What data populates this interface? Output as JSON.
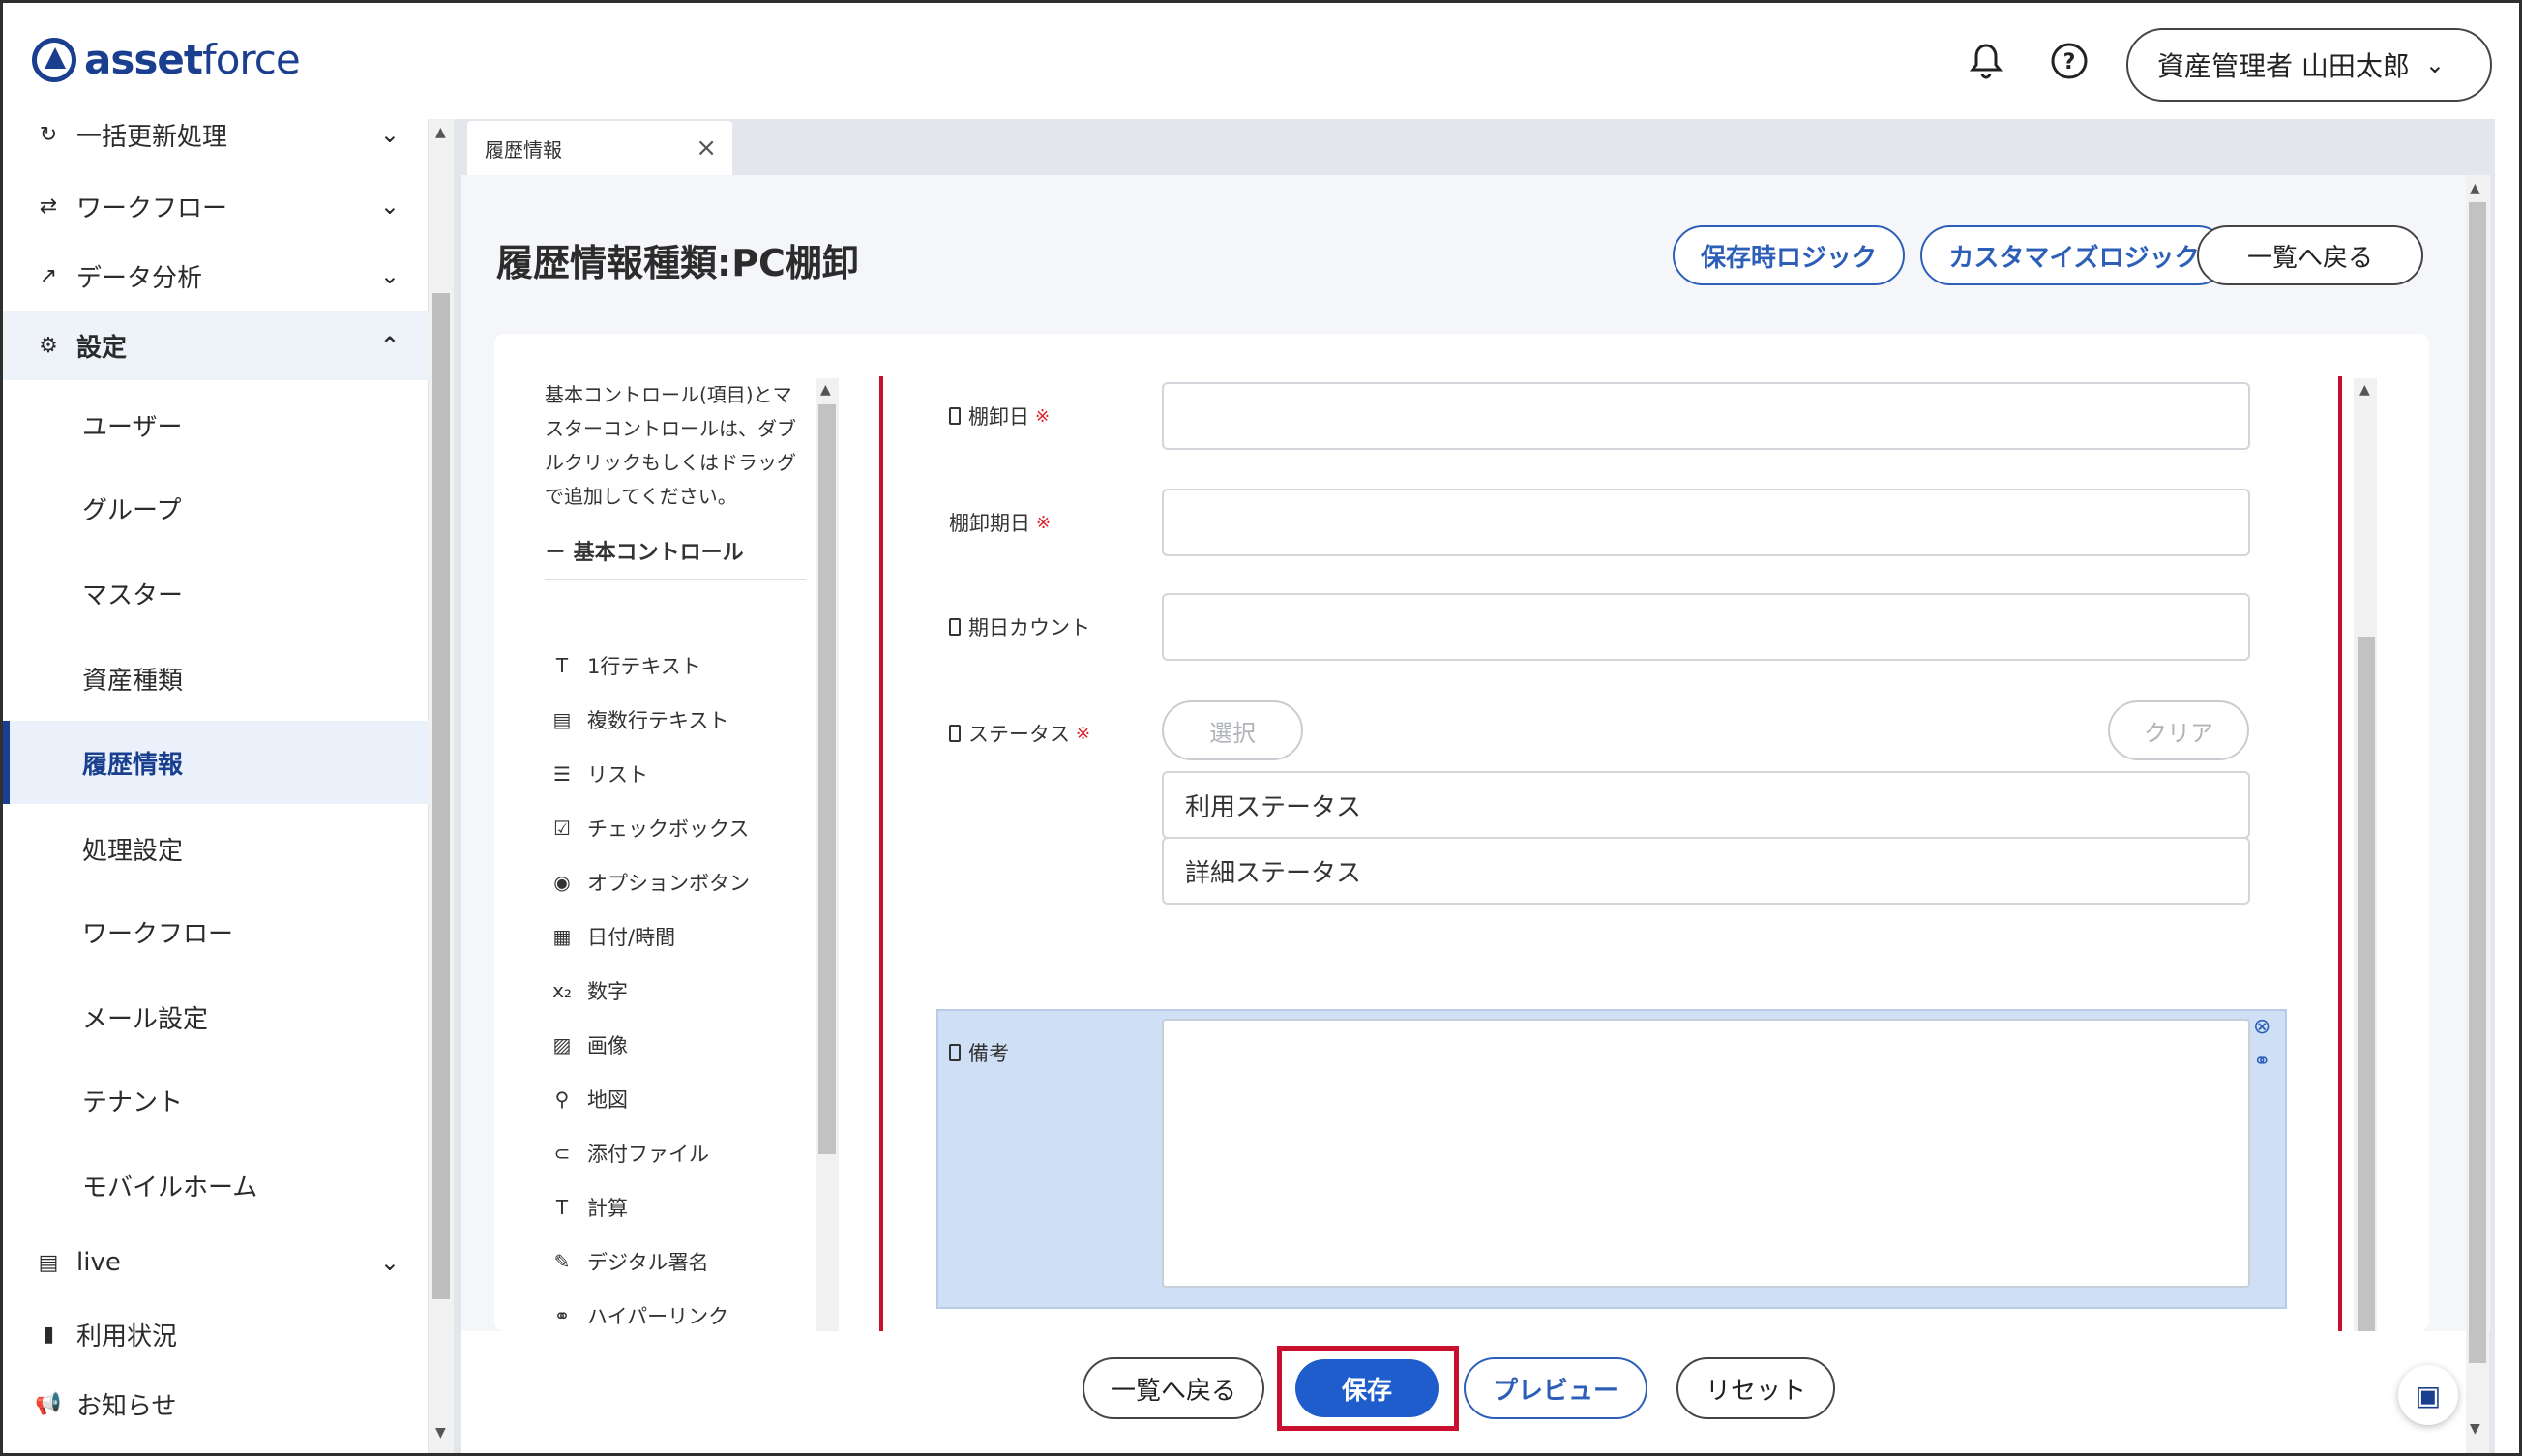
{
  "header": {
    "logo_prefix": "asset",
    "logo_suffix": "force",
    "user_label": "資産管理者 山田太郎"
  },
  "sidebar": {
    "items": [
      {
        "label": "一括更新処理",
        "icon": "refresh-icon"
      },
      {
        "label": "ワークフロー",
        "icon": "workflow-icon"
      },
      {
        "label": "データ分析",
        "icon": "analytics-icon"
      },
      {
        "label": "設定",
        "icon": "gear-icon"
      },
      {
        "label": "ユーザー"
      },
      {
        "label": "グループ"
      },
      {
        "label": "マスター"
      },
      {
        "label": "資産種類"
      },
      {
        "label": "履歴情報"
      },
      {
        "label": "処理設定"
      },
      {
        "label": "ワークフロー"
      },
      {
        "label": "メール設定"
      },
      {
        "label": "テナント"
      },
      {
        "label": "モバイルホーム"
      },
      {
        "label": "live",
        "icon": "live-icon"
      },
      {
        "label": "利用状況",
        "icon": "bar-chart-icon"
      },
      {
        "label": "お知らせ",
        "icon": "megaphone-icon"
      }
    ]
  },
  "tab": {
    "label": "履歴情報"
  },
  "page": {
    "title": "履歴情報種類:PC棚卸",
    "btn_save_logic": "保存時ロジック",
    "btn_custom_logic": "カスタマイズロジック",
    "btn_back_list": "一覧へ戻る"
  },
  "palette": {
    "help": "基本コントロール(項目)とマスターコントロールは、ダブルクリックもしくはドラッグで追加してください。",
    "section": "－ 基本コントロール",
    "items": [
      {
        "label": "1行テキスト",
        "icon": "text-icon"
      },
      {
        "label": "複数行テキスト",
        "icon": "multiline-text-icon"
      },
      {
        "label": "リスト",
        "icon": "list-icon"
      },
      {
        "label": "チェックボックス",
        "icon": "checkbox-icon"
      },
      {
        "label": "オプションボタン",
        "icon": "radio-icon"
      },
      {
        "label": "日付/時間",
        "icon": "calendar-icon"
      },
      {
        "label": "数字",
        "icon": "number-icon"
      },
      {
        "label": "画像",
        "icon": "image-icon"
      },
      {
        "label": "地図",
        "icon": "map-pin-icon"
      },
      {
        "label": "添付ファイル",
        "icon": "attachment-icon"
      },
      {
        "label": "計算",
        "icon": "calc-icon"
      },
      {
        "label": "デジタル署名",
        "icon": "pen-icon"
      },
      {
        "label": "ハイパーリンク",
        "icon": "link-icon"
      }
    ]
  },
  "form": {
    "field1_label": "棚卸日",
    "field2_label": "棚卸期日",
    "field3_label": "期日カウント",
    "field4_label": "ステータス",
    "required_mark": "※",
    "select_btn": "選択",
    "clear_btn": "クリア",
    "status_rows": [
      "利用ステータス",
      "詳細ステータス"
    ],
    "memo_label": "備考"
  },
  "footer": {
    "back": "一覧へ戻る",
    "save": "保存",
    "preview": "プレビュー",
    "reset": "リセット"
  },
  "colors": {
    "brand": "#1b3f8f",
    "primary": "#1f5ccc",
    "highlight": "#c8102e"
  }
}
